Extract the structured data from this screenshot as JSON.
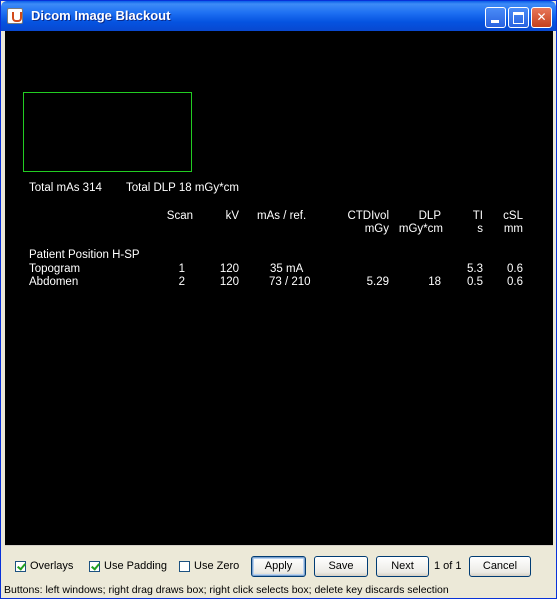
{
  "window": {
    "title": "Dicom Image Blackout"
  },
  "canvas": {
    "totals": {
      "mas": "Total mAs 314",
      "dlp": "Total DLP 18 mGy*cm"
    },
    "headers": {
      "scan": "Scan",
      "kv": "kV",
      "mas": "mAs  / ref.",
      "ctdi": "CTDIvol",
      "ctdi_unit": "mGy",
      "dlp": "DLP",
      "dlp_unit": "mGy*cm",
      "ti": "TI",
      "ti_unit": "s",
      "csl": "cSL",
      "csl_unit": "mm"
    },
    "position": "Patient Position H-SP",
    "rows": [
      {
        "name": "Topogram",
        "scan": "1",
        "kv": "120",
        "mas": "35 mA",
        "ctdi": "",
        "dlp": "",
        "ti": "5.3",
        "csl": "0.6"
      },
      {
        "name": "Abdomen",
        "scan": "2",
        "kv": "120",
        "mas": "73  / 210",
        "ctdi": "5.29",
        "dlp": "18",
        "ti": "0.5",
        "csl": "0.6"
      }
    ]
  },
  "controls": {
    "overlays": {
      "label": "Overlays",
      "checked": true
    },
    "use_padding": {
      "label": "Use Padding",
      "checked": true
    },
    "use_zero": {
      "label": "Use Zero",
      "checked": false
    },
    "apply": "Apply",
    "save": "Save",
    "next": "Next",
    "page": "1 of 1",
    "cancel": "Cancel"
  },
  "status": "Buttons: left windows; right drag draws box; right click selects box; delete key discards selection",
  "colors": {
    "selection_box": "#22cc22",
    "titlebar": "#0553e0",
    "canvas": "#000000"
  }
}
